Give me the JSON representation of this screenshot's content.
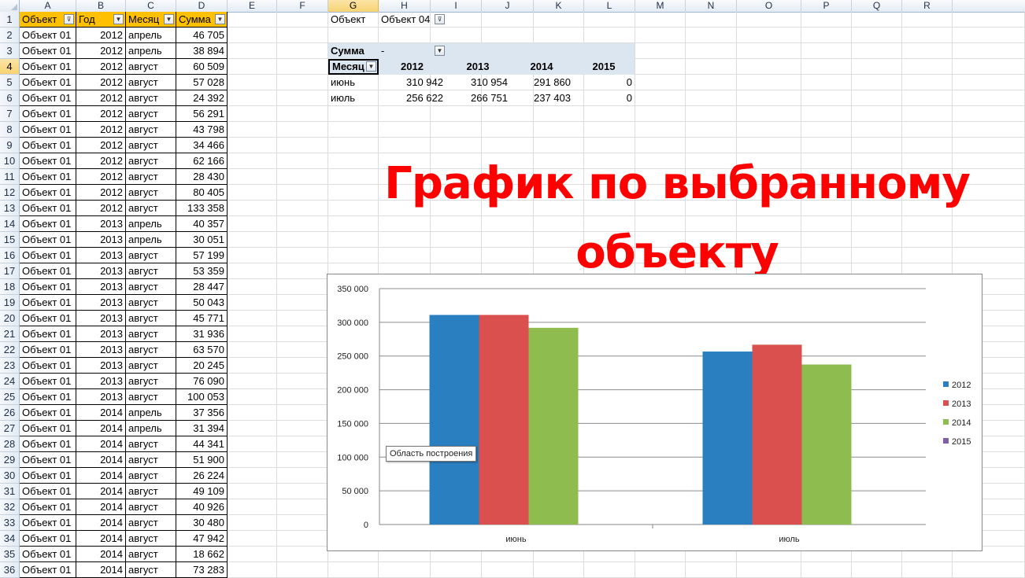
{
  "columns": [
    "A",
    "B",
    "C",
    "D",
    "E",
    "F",
    "G",
    "H",
    "I",
    "J",
    "K",
    "L",
    "M",
    "N",
    "O",
    "P",
    "Q",
    "R"
  ],
  "selected_column": "G",
  "selected_row": "4",
  "table": {
    "headers": [
      "Объект",
      "Год",
      "Месяц",
      "Сумма"
    ],
    "rows": [
      [
        "Объект 01",
        "2012",
        "апрель",
        "46 705"
      ],
      [
        "Объект 01",
        "2012",
        "апрель",
        "38 894"
      ],
      [
        "Объект 01",
        "2012",
        "август",
        "60 509"
      ],
      [
        "Объект 01",
        "2012",
        "август",
        "57 028"
      ],
      [
        "Объект 01",
        "2012",
        "август",
        "24 392"
      ],
      [
        "Объект 01",
        "2012",
        "август",
        "56 291"
      ],
      [
        "Объект 01",
        "2012",
        "август",
        "43 798"
      ],
      [
        "Объект 01",
        "2012",
        "август",
        "34 466"
      ],
      [
        "Объект 01",
        "2012",
        "август",
        "62 166"
      ],
      [
        "Объект 01",
        "2012",
        "август",
        "28 430"
      ],
      [
        "Объект 01",
        "2012",
        "август",
        "80 405"
      ],
      [
        "Объект 01",
        "2012",
        "август",
        "133 358"
      ],
      [
        "Объект 01",
        "2013",
        "апрель",
        "40 357"
      ],
      [
        "Объект 01",
        "2013",
        "апрель",
        "30 051"
      ],
      [
        "Объект 01",
        "2013",
        "август",
        "57 199"
      ],
      [
        "Объект 01",
        "2013",
        "август",
        "53 359"
      ],
      [
        "Объект 01",
        "2013",
        "август",
        "28 447"
      ],
      [
        "Объект 01",
        "2013",
        "август",
        "50 043"
      ],
      [
        "Объект 01",
        "2013",
        "август",
        "45 771"
      ],
      [
        "Объект 01",
        "2013",
        "август",
        "31 936"
      ],
      [
        "Объект 01",
        "2013",
        "август",
        "63 570"
      ],
      [
        "Объект 01",
        "2013",
        "август",
        "20 245"
      ],
      [
        "Объект 01",
        "2013",
        "август",
        "76 090"
      ],
      [
        "Объект 01",
        "2013",
        "август",
        "100 053"
      ],
      [
        "Объект 01",
        "2014",
        "апрель",
        "37 356"
      ],
      [
        "Объект 01",
        "2014",
        "апрель",
        "31 394"
      ],
      [
        "Объект 01",
        "2014",
        "август",
        "44 341"
      ],
      [
        "Объект 01",
        "2014",
        "август",
        "51 900"
      ],
      [
        "Объект 01",
        "2014",
        "август",
        "26 224"
      ],
      [
        "Объект 01",
        "2014",
        "август",
        "49 109"
      ],
      [
        "Объект 01",
        "2014",
        "август",
        "40 926"
      ],
      [
        "Объект 01",
        "2014",
        "август",
        "30 480"
      ],
      [
        "Объект 01",
        "2014",
        "август",
        "47 942"
      ],
      [
        "Объект 01",
        "2014",
        "август",
        "18 662"
      ],
      [
        "Объект 01",
        "2014",
        "август",
        "73 283"
      ]
    ]
  },
  "pivot": {
    "filter_label": "Объект",
    "filter_value": "Объект 04",
    "values_label": "Сумма",
    "values_dash": "-",
    "row_label": "Месяц",
    "years": [
      "2012",
      "2013",
      "2014",
      "2015"
    ],
    "rows": [
      {
        "month": "июнь",
        "values": [
          "310 942",
          "310 954",
          "291 860",
          "0"
        ]
      },
      {
        "month": "июль",
        "values": [
          "256 622",
          "266 751",
          "237 403",
          "0"
        ]
      }
    ]
  },
  "title_lines": [
    "График по выбранному",
    "объекту"
  ],
  "tooltip": "Область построения",
  "colors": {
    "s2012": "#2a7fc1",
    "s2013": "#d9504e",
    "s2014": "#8fbc4e",
    "s2015": "#7f5fa6",
    "title": "#ff0000",
    "header_fill": "#ffc000"
  },
  "chart_data": {
    "type": "bar",
    "categories": [
      "июнь",
      "июль"
    ],
    "series": [
      {
        "name": "2012",
        "values": [
          310942,
          256622
        ]
      },
      {
        "name": "2013",
        "values": [
          310954,
          266751
        ]
      },
      {
        "name": "2014",
        "values": [
          291860,
          237403
        ]
      },
      {
        "name": "2015",
        "values": [
          0,
          0
        ]
      }
    ],
    "ylim": [
      0,
      350000
    ],
    "yticks": [
      "0",
      "50 000",
      "100 000",
      "150 000",
      "200 000",
      "250 000",
      "300 000",
      "350 000"
    ],
    "grid": true,
    "legend": "right"
  }
}
